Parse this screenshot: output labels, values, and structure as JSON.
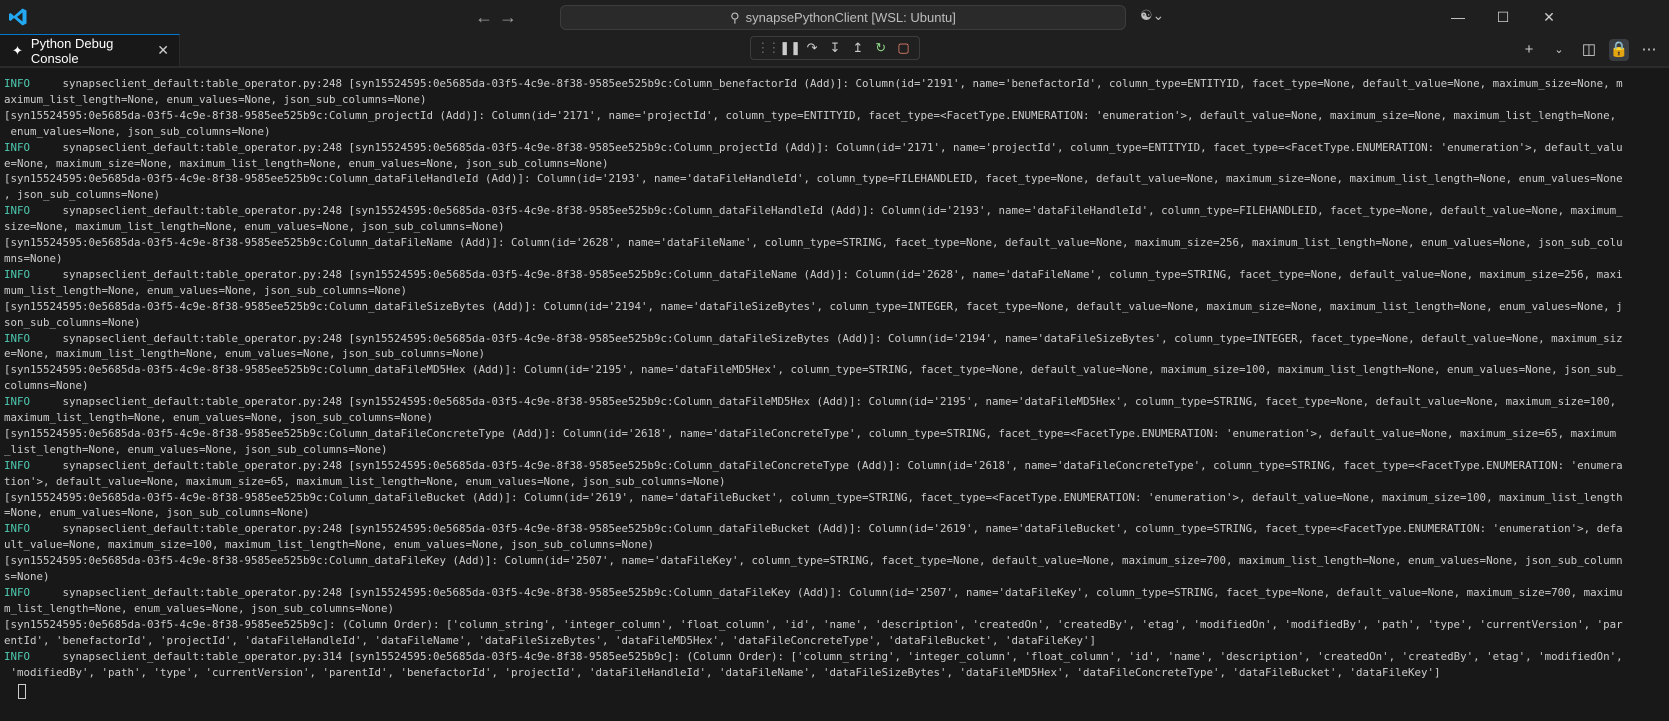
{
  "titlebar": {
    "search_text": "synapsePythonClient [WSL: Ubuntu]",
    "back_icon": "arrow-left-icon",
    "forward_icon": "arrow-right-icon"
  },
  "tab": {
    "label": "Python Debug Console"
  },
  "console": {
    "lines": [
      {
        "level": "INFO",
        "text": "     synapseclient_default:table_operator.py:248 [syn15524595:0e5685da-03f5-4c9e-8f38-9585ee525b9c:Column_benefactorId (Add)]: Column(id='2191', name='benefactorId', column_type=ENTITYID, facet_type=None, default_value=None, maximum_size=None, m"
      },
      {
        "level": "",
        "text": "aximum_list_length=None, enum_values=None, json_sub_columns=None)"
      },
      {
        "level": "",
        "text": "[syn15524595:0e5685da-03f5-4c9e-8f38-9585ee525b9c:Column_projectId (Add)]: Column(id='2171', name='projectId', column_type=ENTITYID, facet_type=<FacetType.ENUMERATION: 'enumeration'>, default_value=None, maximum_size=None, maximum_list_length=None,"
      },
      {
        "level": "",
        "text": " enum_values=None, json_sub_columns=None)"
      },
      {
        "level": "INFO",
        "text": "     synapseclient_default:table_operator.py:248 [syn15524595:0e5685da-03f5-4c9e-8f38-9585ee525b9c:Column_projectId (Add)]: Column(id='2171', name='projectId', column_type=ENTITYID, facet_type=<FacetType.ENUMERATION: 'enumeration'>, default_valu"
      },
      {
        "level": "",
        "text": "e=None, maximum_size=None, maximum_list_length=None, enum_values=None, json_sub_columns=None)"
      },
      {
        "level": "",
        "text": "[syn15524595:0e5685da-03f5-4c9e-8f38-9585ee525b9c:Column_dataFileHandleId (Add)]: Column(id='2193', name='dataFileHandleId', column_type=FILEHANDLEID, facet_type=None, default_value=None, maximum_size=None, maximum_list_length=None, enum_values=None"
      },
      {
        "level": "",
        "text": ", json_sub_columns=None)"
      },
      {
        "level": "INFO",
        "text": "     synapseclient_default:table_operator.py:248 [syn15524595:0e5685da-03f5-4c9e-8f38-9585ee525b9c:Column_dataFileHandleId (Add)]: Column(id='2193', name='dataFileHandleId', column_type=FILEHANDLEID, facet_type=None, default_value=None, maximum_"
      },
      {
        "level": "",
        "text": "size=None, maximum_list_length=None, enum_values=None, json_sub_columns=None)"
      },
      {
        "level": "",
        "text": "[syn15524595:0e5685da-03f5-4c9e-8f38-9585ee525b9c:Column_dataFileName (Add)]: Column(id='2628', name='dataFileName', column_type=STRING, facet_type=None, default_value=None, maximum_size=256, maximum_list_length=None, enum_values=None, json_sub_colu"
      },
      {
        "level": "",
        "text": "mns=None)"
      },
      {
        "level": "INFO",
        "text": "     synapseclient_default:table_operator.py:248 [syn15524595:0e5685da-03f5-4c9e-8f38-9585ee525b9c:Column_dataFileName (Add)]: Column(id='2628', name='dataFileName', column_type=STRING, facet_type=None, default_value=None, maximum_size=256, maxi"
      },
      {
        "level": "",
        "text": "mum_list_length=None, enum_values=None, json_sub_columns=None)"
      },
      {
        "level": "",
        "text": "[syn15524595:0e5685da-03f5-4c9e-8f38-9585ee525b9c:Column_dataFileSizeBytes (Add)]: Column(id='2194', name='dataFileSizeBytes', column_type=INTEGER, facet_type=None, default_value=None, maximum_size=None, maximum_list_length=None, enum_values=None, j"
      },
      {
        "level": "",
        "text": "son_sub_columns=None)"
      },
      {
        "level": "INFO",
        "text": "     synapseclient_default:table_operator.py:248 [syn15524595:0e5685da-03f5-4c9e-8f38-9585ee525b9c:Column_dataFileSizeBytes (Add)]: Column(id='2194', name='dataFileSizeBytes', column_type=INTEGER, facet_type=None, default_value=None, maximum_siz"
      },
      {
        "level": "",
        "text": "e=None, maximum_list_length=None, enum_values=None, json_sub_columns=None)"
      },
      {
        "level": "",
        "text": "[syn15524595:0e5685da-03f5-4c9e-8f38-9585ee525b9c:Column_dataFileMD5Hex (Add)]: Column(id='2195', name='dataFileMD5Hex', column_type=STRING, facet_type=None, default_value=None, maximum_size=100, maximum_list_length=None, enum_values=None, json_sub_"
      },
      {
        "level": "",
        "text": "columns=None)"
      },
      {
        "level": "INFO",
        "text": "     synapseclient_default:table_operator.py:248 [syn15524595:0e5685da-03f5-4c9e-8f38-9585ee525b9c:Column_dataFileMD5Hex (Add)]: Column(id='2195', name='dataFileMD5Hex', column_type=STRING, facet_type=None, default_value=None, maximum_size=100,"
      },
      {
        "level": "",
        "text": "maximum_list_length=None, enum_values=None, json_sub_columns=None)"
      },
      {
        "level": "",
        "text": "[syn15524595:0e5685da-03f5-4c9e-8f38-9585ee525b9c:Column_dataFileConcreteType (Add)]: Column(id='2618', name='dataFileConcreteType', column_type=STRING, facet_type=<FacetType.ENUMERATION: 'enumeration'>, default_value=None, maximum_size=65, maximum"
      },
      {
        "level": "",
        "text": "_list_length=None, enum_values=None, json_sub_columns=None)"
      },
      {
        "level": "INFO",
        "text": "     synapseclient_default:table_operator.py:248 [syn15524595:0e5685da-03f5-4c9e-8f38-9585ee525b9c:Column_dataFileConcreteType (Add)]: Column(id='2618', name='dataFileConcreteType', column_type=STRING, facet_type=<FacetType.ENUMERATION: 'enumera"
      },
      {
        "level": "",
        "text": "tion'>, default_value=None, maximum_size=65, maximum_list_length=None, enum_values=None, json_sub_columns=None)"
      },
      {
        "level": "",
        "text": "[syn15524595:0e5685da-03f5-4c9e-8f38-9585ee525b9c:Column_dataFileBucket (Add)]: Column(id='2619', name='dataFileBucket', column_type=STRING, facet_type=<FacetType.ENUMERATION: 'enumeration'>, default_value=None, maximum_size=100, maximum_list_length"
      },
      {
        "level": "",
        "text": "=None, enum_values=None, json_sub_columns=None)"
      },
      {
        "level": "INFO",
        "text": "     synapseclient_default:table_operator.py:248 [syn15524595:0e5685da-03f5-4c9e-8f38-9585ee525b9c:Column_dataFileBucket (Add)]: Column(id='2619', name='dataFileBucket', column_type=STRING, facet_type=<FacetType.ENUMERATION: 'enumeration'>, defa"
      },
      {
        "level": "",
        "text": "ult_value=None, maximum_size=100, maximum_list_length=None, enum_values=None, json_sub_columns=None)"
      },
      {
        "level": "",
        "text": "[syn15524595:0e5685da-03f5-4c9e-8f38-9585ee525b9c:Column_dataFileKey (Add)]: Column(id='2507', name='dataFileKey', column_type=STRING, facet_type=None, default_value=None, maximum_size=700, maximum_list_length=None, enum_values=None, json_sub_column"
      },
      {
        "level": "",
        "text": "s=None)"
      },
      {
        "level": "INFO",
        "text": "     synapseclient_default:table_operator.py:248 [syn15524595:0e5685da-03f5-4c9e-8f38-9585ee525b9c:Column_dataFileKey (Add)]: Column(id='2507', name='dataFileKey', column_type=STRING, facet_type=None, default_value=None, maximum_size=700, maximu"
      },
      {
        "level": "",
        "text": "m_list_length=None, enum_values=None, json_sub_columns=None)"
      },
      {
        "level": "",
        "text": "[syn15524595:0e5685da-03f5-4c9e-8f38-9585ee525b9c]: (Column Order): ['column_string', 'integer_column', 'float_column', 'id', 'name', 'description', 'createdOn', 'createdBy', 'etag', 'modifiedOn', 'modifiedBy', 'path', 'type', 'currentVersion', 'par"
      },
      {
        "level": "",
        "text": "entId', 'benefactorId', 'projectId', 'dataFileHandleId', 'dataFileName', 'dataFileSizeBytes', 'dataFileMD5Hex', 'dataFileConcreteType', 'dataFileBucket', 'dataFileKey']"
      },
      {
        "level": "INFO",
        "text": "     synapseclient_default:table_operator.py:314 [syn15524595:0e5685da-03f5-4c9e-8f38-9585ee525b9c]: (Column Order): ['column_string', 'integer_column', 'float_column', 'id', 'name', 'description', 'createdOn', 'createdBy', 'etag', 'modifiedOn',"
      },
      {
        "level": "",
        "text": " 'modifiedBy', 'path', 'type', 'currentVersion', 'parentId', 'benefactorId', 'projectId', 'dataFileHandleId', 'dataFileName', 'dataFileSizeBytes', 'dataFileMD5Hex', 'dataFileConcreteType', 'dataFileBucket', 'dataFileKey']"
      }
    ]
  }
}
